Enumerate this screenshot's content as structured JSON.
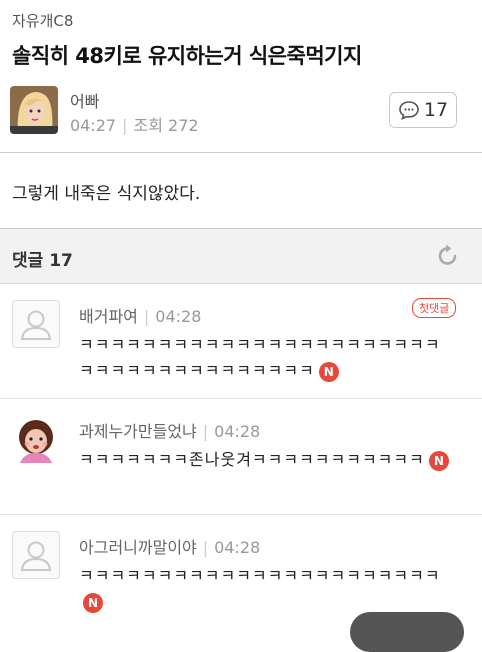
{
  "post": {
    "board": "자유개C8",
    "title": "솔직히 48키로 유지하는거 식은죽먹기지",
    "author": "어빠",
    "time": "04:27",
    "views": "조회 272",
    "comment_count": "17",
    "body": "그렇게 내죽은 식지않았다."
  },
  "comments_header": {
    "label": "댓글",
    "count": "17"
  },
  "comments": [
    {
      "name": "배거파여",
      "time": "04:28",
      "text": "ㅋㅋㅋㅋㅋㅋㅋㅋㅋㅋㅋㅋㅋㅋㅋㅋㅋㅋㅋㅋㅋㅋㅋㅋㅋㅋㅋㅋㅋㅋㅋㅋㅋㅋㅋㅋㅋㅋ",
      "badge": "N",
      "first_label": "첫댓글"
    },
    {
      "name": "과제누가만들었냐",
      "time": "04:28",
      "text": "ㅋㅋㅋㅋㅋㅋㅋ존나웃겨ㅋㅋㅋㅋㅋㅋㅋㅋㅋㅋㅋ",
      "badge": "N"
    },
    {
      "name": "아그러니까말이야",
      "time": "04:28",
      "text": "ㅋㅋㅋㅋㅋㅋㅋㅋㅋㅋㅋㅋㅋㅋㅋㅋㅋㅋㅋㅋㅋㅋㅋ",
      "badge": "N"
    }
  ]
}
